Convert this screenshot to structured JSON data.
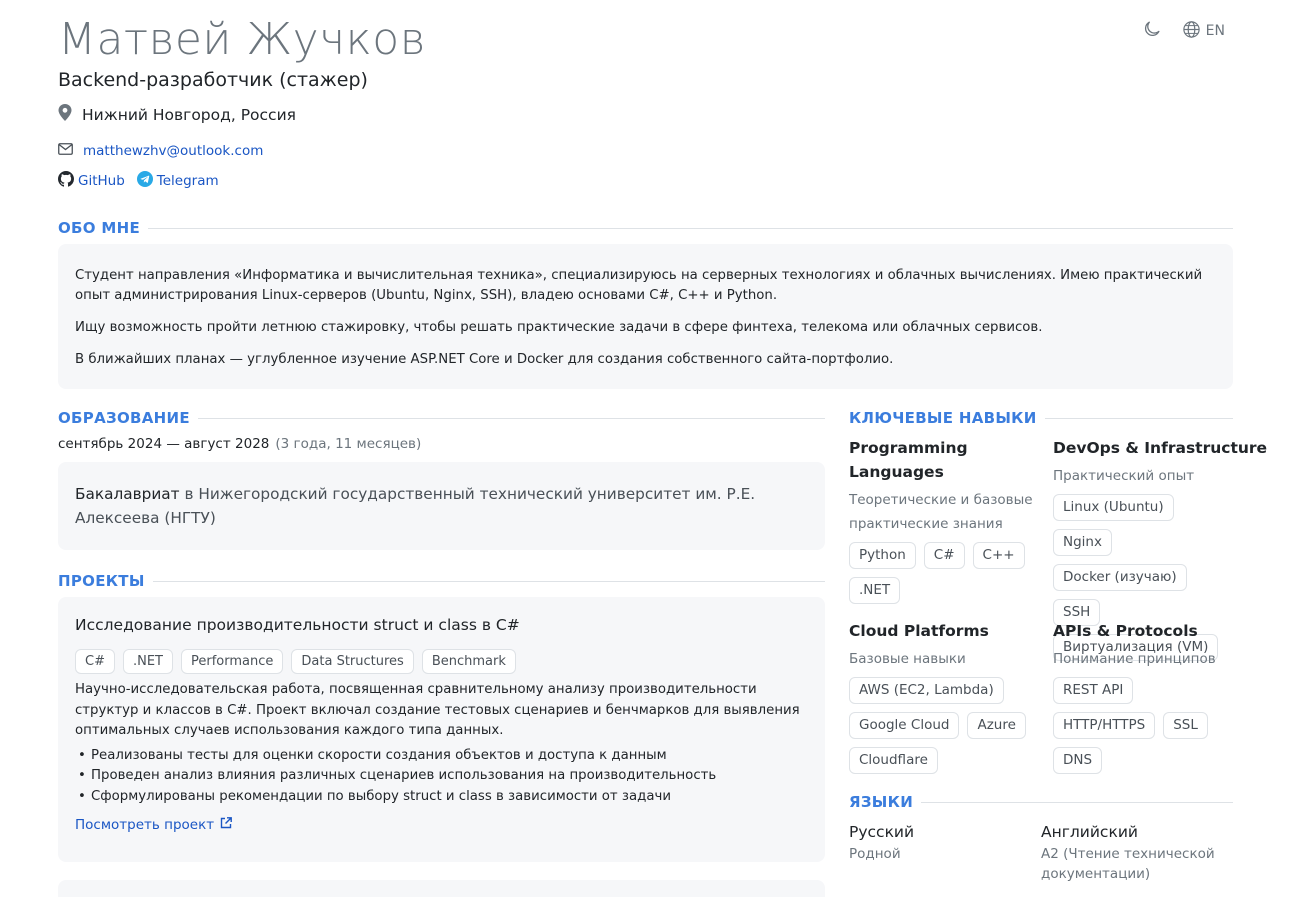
{
  "header": {
    "name": "Матвей Жучков",
    "role": "Backend-разработчик (стажер)",
    "location": "Нижний Новгород, Россия",
    "email": "matthewzhv@outlook.com",
    "links": [
      {
        "label": "GitHub",
        "icon": "github-icon"
      },
      {
        "label": "Telegram",
        "icon": "telegram-icon"
      }
    ],
    "language_toggle": "EN"
  },
  "about": {
    "title": "ОБО МНЕ",
    "paragraphs": [
      "Студент направления «Информатика и вычислительная техника», специализируюсь на серверных технологиях и облачных вычислениях. Имею практический опыт администрирования Linux-серверов (Ubuntu, Nginx, SSH), владею основами C#, C++ и Python.",
      "Ищу возможность пройти летнюю стажировку, чтобы решать практические задачи в сфере финтеха, телекома или облачных сервисов.",
      "В ближайших планах — углубленное изучение ASP.NET Core и Docker для создания собственного сайта-портфолио."
    ]
  },
  "education": {
    "title": "ОБРАЗОВАНИЕ",
    "dates": "сентябрь 2024 — август 2028",
    "duration": "(3 года, 11 месяцев)",
    "degree": "Бакалавриат",
    "connector": "в",
    "university": "Нижегородский государственный технический университет им. Р.Е. Алексеева (НГТУ)"
  },
  "projects": {
    "title": "ПРОЕКТЫ",
    "items": [
      {
        "title": "Исследование производительности struct и class в C#",
        "tags": [
          "C#",
          ".NET",
          "Performance",
          "Data Structures",
          "Benchmark"
        ],
        "description": "Научно-исследовательская работа, посвященная сравнительному анализу производительности структур и классов в C#. Проект включал создание тестовых сценариев и бенчмарков для выявления оптимальных случаев использования каждого типа данных.",
        "bullets": [
          "Реализованы тесты для оценки скорости создания объектов и доступа к данным",
          "Проведен анализ влияния различных сценариев использования на производительность",
          "Сформулированы рекомендации по выбору struct и class в зависимости от задачи"
        ],
        "link": "Посмотреть проект"
      }
    ]
  },
  "skills": {
    "title": "КЛЮЧЕВЫЕ НАВЫКИ",
    "groups": [
      {
        "name": "Programming Languages",
        "level": "Теоретические и базовые практические знания",
        "items": [
          "Python",
          "C#",
          "C++",
          ".NET"
        ]
      },
      {
        "name": "DevOps & Infrastructure",
        "level": "Практический опыт",
        "items": [
          "Linux (Ubuntu)",
          "Nginx",
          "Docker (изучаю)",
          "SSH",
          "Виртуализация (VM)"
        ]
      },
      {
        "name": "Cloud Platforms",
        "level": "Базовые навыки",
        "items": [
          "AWS (EC2, Lambda)",
          "Google Cloud",
          "Azure",
          "Cloudflare"
        ]
      },
      {
        "name": "APIs & Protocols",
        "level": "Понимание принципов",
        "items": [
          "REST API",
          "HTTP/HTTPS",
          "SSL",
          "DNS"
        ]
      }
    ]
  },
  "languages": {
    "title": "ЯЗЫКИ",
    "items": [
      {
        "name": "Русский",
        "level": "Родной"
      },
      {
        "name": "Английский",
        "level": "A2 (Чтение технической документации)"
      }
    ]
  }
}
